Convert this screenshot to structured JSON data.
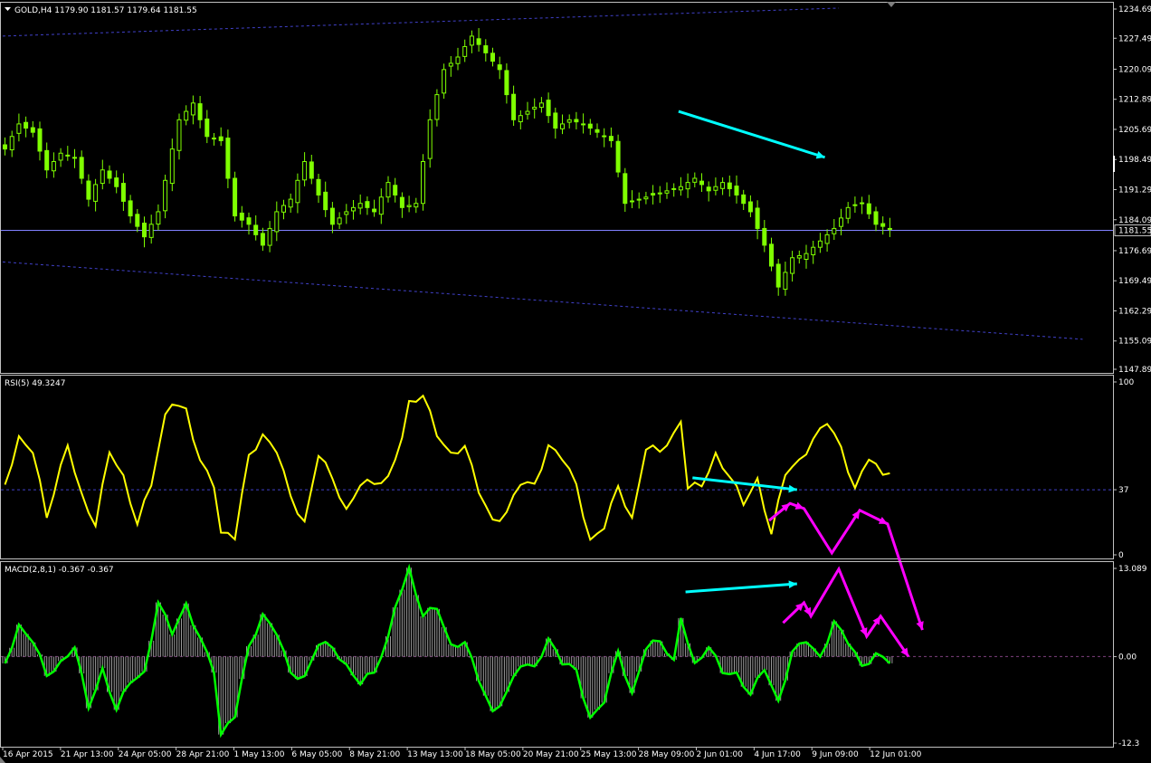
{
  "colors": {
    "background": "#000000",
    "frame": "#c0c0c0",
    "bull_candle": "#7fff00",
    "bear_candle": "#ffffff",
    "channel": "#4040c8",
    "price_line": "#8080ff",
    "rsi_line": "#ffff00",
    "macd_line": "#00ff00",
    "macd_hist": "#9a9a9a",
    "arrow_cyan": "#00ffff",
    "arrow_magenta": "#ff00ff"
  },
  "chart_data": [
    {
      "type": "candlestick",
      "title": "GOLD,H4  1179.90 1181.57 1179.64 1181.55",
      "symbol": "GOLD,H4",
      "ohlc": [
        "1179.90",
        "1181.57",
        "1179.64",
        "1181.55"
      ],
      "current_price": 1181.55,
      "current_price_label": "1181.55",
      "ylim": [
        1147.89,
        1234.69
      ],
      "y_ticks": [
        "1234.69",
        "1227.49",
        "1220.09",
        "1212.89",
        "1205.69",
        "1198.49",
        "1191.29",
        "1184.09",
        "1176.69",
        "1169.49",
        "1162.29",
        "1155.09",
        "1147.89"
      ],
      "x_ticks": [
        "16 Apr 2015",
        "21 Apr 13:00",
        "24 Apr 05:00",
        "28 Apr 21:00",
        "1 May 13:00",
        "6 May 05:00",
        "8 May 21:00",
        "13 May 13:00",
        "18 May 05:00",
        "20 May 21:00",
        "25 May 13:00",
        "28 May 09:00",
        "2 Jun 01:00",
        "4 Jun 17:00",
        "9 Jun 09:00",
        "12 Jun 01:00"
      ],
      "close_path": [
        [
          0,
          1201
        ],
        [
          2,
          1207
        ],
        [
          4,
          1205
        ],
        [
          6,
          1196
        ],
        [
          8,
          1200
        ],
        [
          10,
          1199
        ],
        [
          12,
          1189
        ],
        [
          14,
          1196
        ],
        [
          16,
          1192
        ],
        [
          18,
          1185
        ],
        [
          20,
          1180
        ],
        [
          22,
          1186
        ],
        [
          24,
          1201
        ],
        [
          25,
          1208
        ],
        [
          27,
          1212
        ],
        [
          29,
          1204
        ],
        [
          31,
          1203
        ],
        [
          33,
          1185
        ],
        [
          35,
          1183
        ],
        [
          37,
          1178
        ],
        [
          39,
          1186
        ],
        [
          41,
          1189
        ],
        [
          43,
          1198
        ],
        [
          45,
          1190
        ],
        [
          47,
          1183
        ],
        [
          49,
          1186
        ],
        [
          51,
          1188
        ],
        [
          53,
          1186
        ],
        [
          55,
          1193
        ],
        [
          57,
          1187
        ],
        [
          59,
          1188
        ],
        [
          61,
          1208
        ],
        [
          63,
          1220
        ],
        [
          65,
          1223
        ],
        [
          67,
          1228
        ],
        [
          69,
          1224
        ],
        [
          71,
          1220
        ],
        [
          73,
          1208
        ],
        [
          75,
          1210
        ],
        [
          77,
          1212
        ],
        [
          79,
          1206
        ],
        [
          81,
          1208
        ],
        [
          83,
          1207
        ],
        [
          85,
          1205
        ],
        [
          87,
          1203
        ],
        [
          89,
          1188
        ],
        [
          91,
          1189
        ],
        [
          93,
          1190
        ],
        [
          95,
          1191
        ],
        [
          97,
          1192
        ],
        [
          99,
          1194
        ],
        [
          101,
          1191
        ],
        [
          103,
          1193
        ],
        [
          105,
          1190
        ],
        [
          107,
          1186
        ],
        [
          109,
          1178
        ],
        [
          111,
          1168
        ],
        [
          113,
          1175
        ],
        [
          115,
          1176
        ],
        [
          117,
          1179
        ],
        [
          119,
          1182
        ],
        [
          121,
          1187
        ],
        [
          123,
          1188
        ],
        [
          125,
          1183
        ],
        [
          127,
          1182
        ]
      ],
      "channel_upper": [
        [
          0,
          1228
        ],
        [
          120,
          1234.7
        ]
      ],
      "channel_lower": [
        [
          0,
          1174
        ],
        [
          155,
          1155.5
        ]
      ],
      "arrow": {
        "color": "cyan",
        "from": [
          97,
          1210
        ],
        "to": [
          118,
          1199
        ]
      }
    },
    {
      "type": "line",
      "title": "RSI(5) 49.3247",
      "indicator": "RSI(5)",
      "value_label": "49.3247",
      "ylim": [
        0,
        100
      ],
      "y_ticks": [
        "100",
        "37",
        "0"
      ],
      "level": 37,
      "series": [
        {
          "values": [
            [
              0,
              40
            ],
            [
              2,
              65
            ],
            [
              4,
              58
            ],
            [
              6,
              20
            ],
            [
              8,
              50
            ],
            [
              9,
              65
            ],
            [
              11,
              35
            ],
            [
              13,
              18
            ],
            [
              15,
              60
            ],
            [
              17,
              42
            ],
            [
              19,
              15
            ],
            [
              21,
              40
            ],
            [
              23,
              80
            ],
            [
              24,
              90
            ],
            [
              26,
              85
            ],
            [
              28,
              55
            ],
            [
              30,
              40
            ],
            [
              31,
              10
            ],
            [
              33,
              8
            ],
            [
              35,
              55
            ],
            [
              37,
              68
            ],
            [
              39,
              62
            ],
            [
              41,
              35
            ],
            [
              43,
              18
            ],
            [
              45,
              58
            ],
            [
              47,
              42
            ],
            [
              49,
              22
            ],
            [
              51,
              40
            ],
            [
              53,
              42
            ],
            [
              55,
              45
            ],
            [
              57,
              70
            ],
            [
              58,
              88
            ],
            [
              60,
              92
            ],
            [
              62,
              68
            ],
            [
              64,
              55
            ],
            [
              66,
              62
            ],
            [
              68,
              38
            ],
            [
              70,
              20
            ],
            [
              72,
              25
            ],
            [
              74,
              42
            ],
            [
              76,
              38
            ],
            [
              78,
              60
            ],
            [
              80,
              55
            ],
            [
              82,
              40
            ],
            [
              84,
              8
            ],
            [
              86,
              18
            ],
            [
              88,
              40
            ],
            [
              90,
              18
            ],
            [
              92,
              60
            ],
            [
              94,
              58
            ],
            [
              96,
              68
            ],
            [
              97,
              78
            ],
            [
              98,
              40
            ],
            [
              100,
              42
            ],
            [
              102,
              58
            ],
            [
              104,
              45
            ],
            [
              106,
              28
            ],
            [
              108,
              40
            ],
            [
              110,
              10
            ],
            [
              112,
              48
            ],
            [
              114,
              55
            ],
            [
              116,
              68
            ],
            [
              118,
              78
            ],
            [
              120,
              60
            ],
            [
              122,
              35
            ],
            [
              124,
              55
            ],
            [
              126,
              45
            ],
            [
              127,
              49.3
            ]
          ]
        }
      ],
      "arrows": [
        {
          "color": "cyan",
          "from": [
            99,
            44
          ],
          "to": [
            114,
            37
          ]
        },
        {
          "color": "magenta",
          "path": [
            [
              110,
              19
            ],
            [
              113,
              29
            ],
            [
              115,
              26
            ],
            [
              119,
              0
            ],
            [
              123,
              25
            ],
            [
              127,
              17
            ],
            [
              132,
              -45
            ]
          ]
        }
      ]
    },
    {
      "type": "line",
      "title": "MACD(2,8,1) -0.367 -0.367",
      "indicator": "MACD(2,8,1)",
      "value_label": "-0.367 -0.367",
      "ylim": [
        -12.3,
        13.089
      ],
      "y_ticks": [
        "13.089",
        "0.00",
        "-12.3"
      ],
      "level": 0,
      "series": [
        {
          "values": [
            [
              0,
              -1
            ],
            [
              2,
              4
            ],
            [
              4,
              2
            ],
            [
              6,
              -3
            ],
            [
              8,
              -1
            ],
            [
              10,
              2
            ],
            [
              12,
              -7
            ],
            [
              14,
              -2
            ],
            [
              16,
              -8
            ],
            [
              18,
              -4
            ],
            [
              20,
              -3
            ],
            [
              22,
              8
            ],
            [
              24,
              4
            ],
            [
              26,
              8
            ],
            [
              28,
              3
            ],
            [
              30,
              -2
            ],
            [
              31,
              -12
            ],
            [
              33,
              -9
            ],
            [
              35,
              1
            ],
            [
              37,
              6
            ],
            [
              39,
              4
            ],
            [
              41,
              -2
            ],
            [
              43,
              -3
            ],
            [
              45,
              2
            ],
            [
              47,
              1
            ],
            [
              49,
              -2
            ],
            [
              51,
              -4
            ],
            [
              53,
              -2
            ],
            [
              55,
              3
            ],
            [
              56,
              8
            ],
            [
              58,
              13
            ],
            [
              60,
              6
            ],
            [
              62,
              7
            ],
            [
              64,
              1
            ],
            [
              66,
              2
            ],
            [
              68,
              -3
            ],
            [
              70,
              -8
            ],
            [
              72,
              -5
            ],
            [
              74,
              -1
            ],
            [
              76,
              -2
            ],
            [
              78,
              2
            ],
            [
              80,
              -1
            ],
            [
              82,
              -2
            ],
            [
              84,
              -9
            ],
            [
              86,
              -6
            ],
            [
              88,
              1
            ],
            [
              90,
              -6
            ],
            [
              92,
              1
            ],
            [
              94,
              2
            ],
            [
              96,
              -1
            ],
            [
              97,
              6
            ],
            [
              99,
              -1
            ],
            [
              101,
              2
            ],
            [
              103,
              -2
            ],
            [
              105,
              -3
            ],
            [
              107,
              -6
            ],
            [
              109,
              -2
            ],
            [
              111,
              -7
            ],
            [
              113,
              1
            ],
            [
              115,
              3
            ],
            [
              117,
              0
            ],
            [
              119,
              5
            ],
            [
              121,
              2
            ],
            [
              123,
              -2
            ],
            [
              125,
              0
            ],
            [
              127,
              -0.4
            ]
          ]
        }
      ],
      "histogram": "same",
      "arrows": [
        {
          "color": "cyan",
          "from": [
            98,
            9.6
          ],
          "to": [
            114,
            10.8
          ]
        },
        {
          "color": "magenta",
          "path": [
            [
              112,
              5
            ],
            [
              115,
              8
            ],
            [
              116,
              6
            ],
            [
              120,
              13
            ],
            [
              124,
              3
            ],
            [
              126,
              6
            ],
            [
              130,
              0
            ]
          ]
        }
      ]
    }
  ]
}
